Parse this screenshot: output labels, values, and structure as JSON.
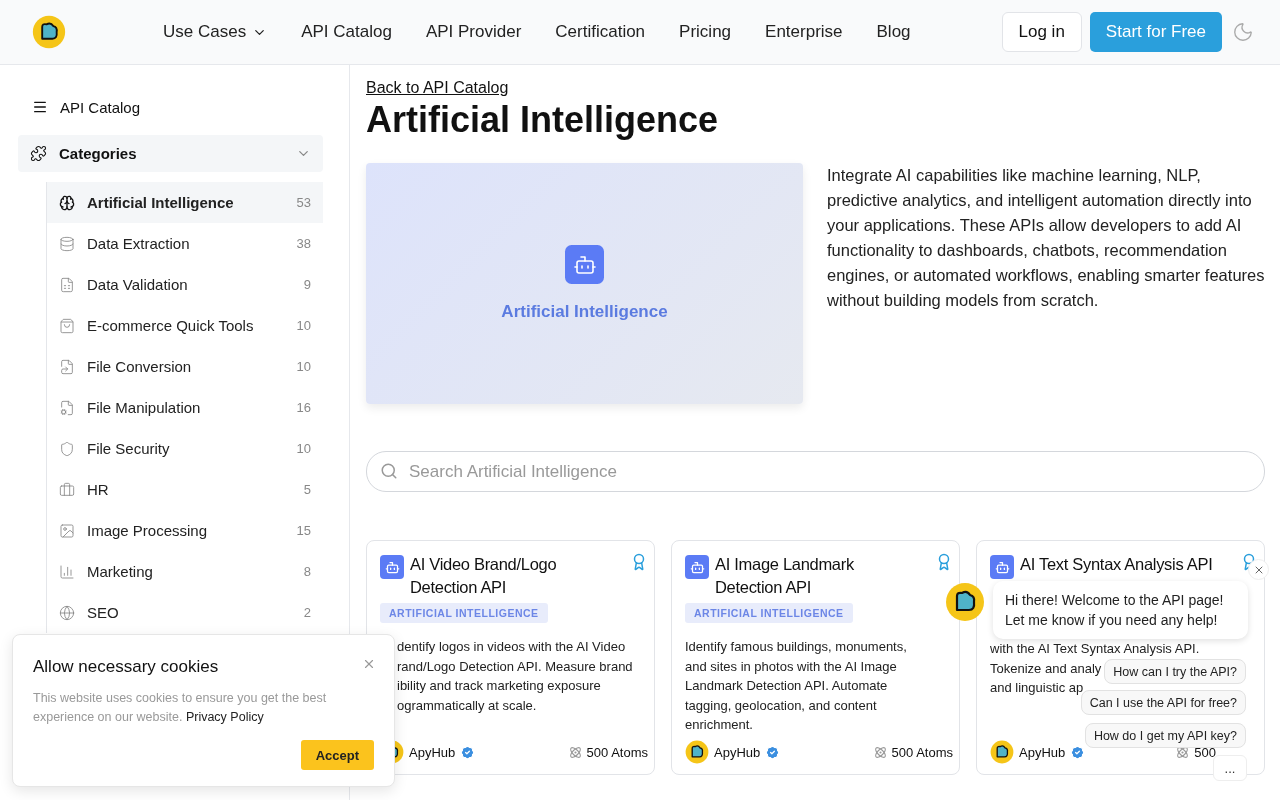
{
  "header": {
    "nav": [
      {
        "label": "Use Cases",
        "dropdown": true
      },
      {
        "label": "API Catalog",
        "dropdown": false
      },
      {
        "label": "API Provider",
        "dropdown": false
      },
      {
        "label": "Certification",
        "dropdown": false
      },
      {
        "label": "Pricing",
        "dropdown": false
      },
      {
        "label": "Enterprise",
        "dropdown": false
      },
      {
        "label": "Blog",
        "dropdown": false
      }
    ],
    "login": "Log in",
    "signup": "Start for Free"
  },
  "sidebar": {
    "title": "API Catalog",
    "section": {
      "label": "Categories",
      "expanded": true
    },
    "items": [
      {
        "label": "Artificial Intelligence",
        "count": "53",
        "selected": true
      },
      {
        "label": "Data Extraction",
        "count": "38",
        "selected": false
      },
      {
        "label": "Data Validation",
        "count": "9",
        "selected": false
      },
      {
        "label": "E-commerce Quick Tools",
        "count": "10",
        "selected": false
      },
      {
        "label": "File Conversion",
        "count": "10",
        "selected": false
      },
      {
        "label": "File Manipulation",
        "count": "16",
        "selected": false
      },
      {
        "label": "File Security",
        "count": "10",
        "selected": false
      },
      {
        "label": "HR",
        "count": "5",
        "selected": false
      },
      {
        "label": "Image Processing",
        "count": "15",
        "selected": false
      },
      {
        "label": "Marketing",
        "count": "8",
        "selected": false
      },
      {
        "label": "SEO",
        "count": "2",
        "selected": false
      }
    ]
  },
  "main": {
    "back_link": "Back to API Catalog",
    "title": "Artificial Intelligence",
    "banner_label": "Artificial Intelligence",
    "description": "Integrate AI capabilities like machine learning, NLP, predictive analytics, and intelligent automation directly into your applications. These APIs allow developers to add AI functionality to dashboards, chatbots, recommendation engines, or automated workflows, enabling smarter features without building models from scratch.",
    "search": {
      "placeholder": "Search Artificial Intelligence"
    },
    "cards": [
      {
        "title": "AI Video Brand/Logo Detection API",
        "tag": "ARTIFICIAL INTELLIGENCE",
        "lines": [
          "dentify logos in videos with the AI Video",
          "rand/Logo Detection API. Measure brand",
          "ibility and track marketing exposure",
          "ogrammatically at scale."
        ],
        "provider": "ApyHub",
        "price": "500 Atoms"
      },
      {
        "title": "AI Image Landmark Detection API",
        "tag": "ARTIFICIAL INTELLIGENCE",
        "lines": [
          "Identify famous buildings, monuments,",
          "and sites in photos with the AI Image",
          "Landmark Detection API. Automate",
          "tagging, geolocation, and content",
          "enrichment."
        ],
        "provider": "ApyHub",
        "price": "500 Atoms"
      },
      {
        "title": "AI Text Syntax Analysis API",
        "lines": [
          "with the AI Text Syntax Analysis API.",
          "Tokenize and analy",
          "and linguistic ap"
        ],
        "provider": "ApyHub",
        "price": "500"
      }
    ]
  },
  "cookie": {
    "title": "Allow necessary cookies",
    "text": "This website uses cookies to ensure you get the best experience on our website.",
    "link": "Privacy Policy",
    "accept": "Accept"
  },
  "chat": {
    "greeting": [
      "Hi there! Welcome to the API page!",
      "Let me know if you need any help!"
    ],
    "suggestions": [
      "How can I try the API?",
      "Can I use the API for free?",
      "How do I get my API key?"
    ],
    "more": "..."
  }
}
